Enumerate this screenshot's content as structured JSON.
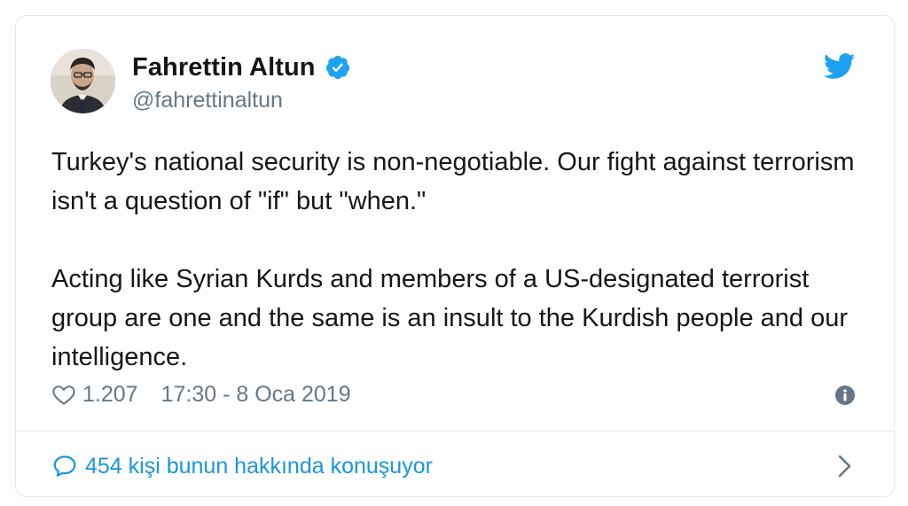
{
  "author": {
    "name": "Fahrettin Altun",
    "handle": "@fahrettinaltun",
    "verified": true
  },
  "tweet": {
    "paragraph_1": "Turkey's national security is non-negotiable. Our fight against terrorism isn't a question of \"if\" but \"when.\"",
    "paragraph_2": "Acting like Syrian Kurds and members of a US-designated terrorist group are one and the same is an insult to the Kurdish people and our intelligence."
  },
  "meta": {
    "likes": "1.207",
    "timestamp": "17:30 - 8 Oca 2019"
  },
  "footer": {
    "conversation_label": "454 kişi bunun hakkında konuşuyor"
  },
  "icons": {
    "brand": "twitter-bird-icon",
    "verified": "verified-badge-icon",
    "like": "heart-icon",
    "info": "info-icon",
    "reply": "speech-bubble-icon",
    "chevron": "chevron-right-icon"
  },
  "colors": {
    "brand_blue": "#1da1f2",
    "link_blue": "#1b95e0",
    "muted_text": "#657786",
    "border": "#e1e8ed",
    "text": "#14171a"
  }
}
